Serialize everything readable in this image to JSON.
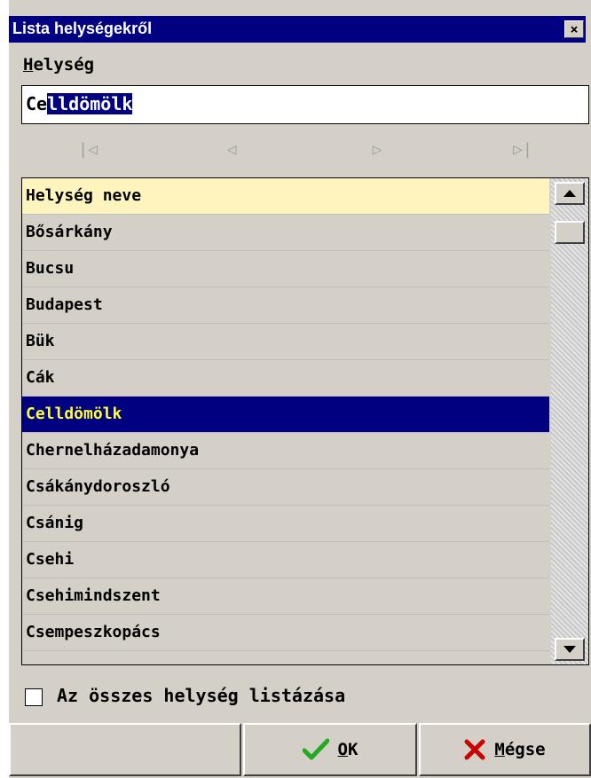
{
  "window": {
    "title": "Lista helységekről",
    "close_label": "×"
  },
  "field": {
    "label_first": "H",
    "label_rest": "elység",
    "value_plain": "Ce",
    "value_selected": "lldömölk"
  },
  "nav": {
    "first": "|◁",
    "prev": "◁",
    "next": "▷",
    "last": "▷|"
  },
  "list": {
    "header": "Helység neve",
    "items": [
      "Bősárkány",
      "Bucsu",
      "Budapest",
      "Bük",
      "Cák",
      "Celldömölk",
      "Chernelházadamonya",
      "Csákánydoroszló",
      "Csánig",
      "Csehi",
      "Csehimindszent",
      "Csempeszkopács"
    ],
    "selected_index": 5
  },
  "checkbox": {
    "label": "Az összes helység listázása",
    "checked": false
  },
  "buttons": {
    "ok_underlined": "O",
    "ok_rest": "K",
    "cancel_underlined": "M",
    "cancel_rest": "égse"
  },
  "colors": {
    "title_bg": "#000080",
    "selected_bg": "#000080",
    "selected_fg": "#ffff33",
    "header_bg": "#fff4bd",
    "ok_icon": "#22aa22",
    "cancel_icon": "#cc0000"
  },
  "icons": {
    "ok": "checkmark-icon",
    "cancel": "x-icon"
  }
}
